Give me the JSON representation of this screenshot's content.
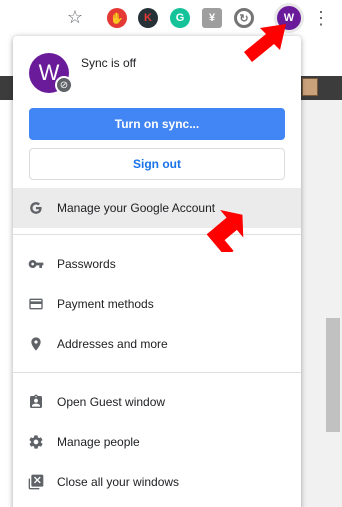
{
  "toolbar": {
    "star_icon": "star-outline-icon",
    "extensions": [
      "adblock-icon",
      "k-extension-icon",
      "grammarly-icon",
      "y-extension-icon",
      "sync-extension-icon"
    ],
    "ext_k_letter": "K",
    "ext_g_letter": "G",
    "profile_letter": "W",
    "menu_icon": "three-dot-menu-icon"
  },
  "profile_menu": {
    "avatar_letter": "W",
    "sync_status": "Sync is off",
    "turn_on_sync_label": "Turn on sync...",
    "sign_out_label": "Sign out",
    "manage_account_label": "Manage your Google Account",
    "autofill_items": [
      {
        "icon": "key-icon",
        "label": "Passwords"
      },
      {
        "icon": "credit-card-icon",
        "label": "Payment methods"
      },
      {
        "icon": "location-pin-icon",
        "label": "Addresses and more"
      }
    ],
    "people_items": [
      {
        "icon": "guest-badge-icon",
        "label": "Open Guest window"
      },
      {
        "icon": "gear-icon",
        "label": "Manage people"
      },
      {
        "icon": "close-window-icon",
        "label": "Close all your windows"
      }
    ]
  },
  "colors": {
    "accent": "#4285f4",
    "link": "#1a73e8",
    "avatar": "#6a1b9a",
    "arrow": "#ff0000"
  }
}
